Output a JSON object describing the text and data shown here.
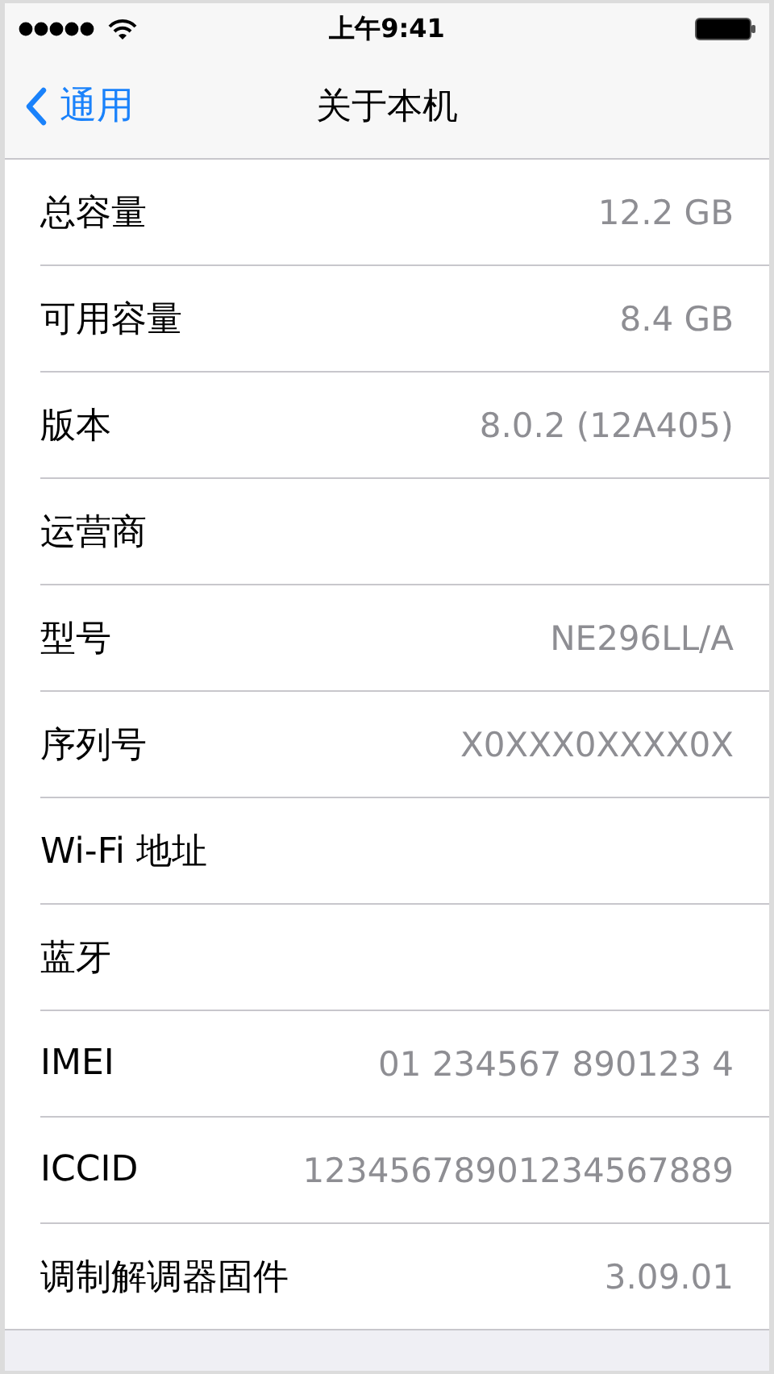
{
  "status_bar": {
    "time": "上午9:41"
  },
  "nav_bar": {
    "back": "通用",
    "title": "关于本机"
  },
  "rows": [
    {
      "label": "总容量",
      "value": "12.2 GB"
    },
    {
      "label": "可用容量",
      "value": "8.4 GB"
    },
    {
      "label": "版本",
      "value": "8.0.2 (12A405)"
    },
    {
      "label": "运营商"
    },
    {
      "label": "型号",
      "value": "NE296LL/A"
    },
    {
      "label": "序列号",
      "value": "X0XXX0XXXX0X"
    },
    {
      "label": "Wi-Fi 地址"
    },
    {
      "label": "蓝牙"
    },
    {
      "label": "IMEI",
      "value": "01 234567 890123 4"
    },
    {
      "label": "ICCID",
      "value": "12345678901234567889"
    },
    {
      "label": "调制解调器固件",
      "value": "3.09.01"
    }
  ]
}
